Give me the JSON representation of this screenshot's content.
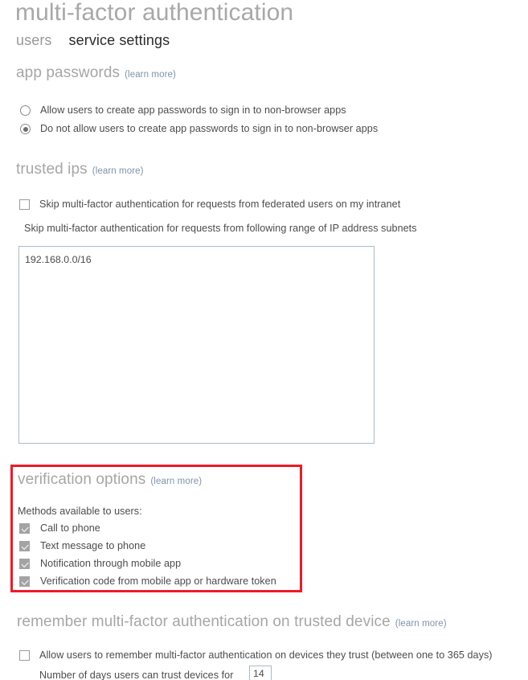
{
  "header": {
    "title": "multi-factor authentication",
    "tabs": [
      {
        "label": "users",
        "active": false
      },
      {
        "label": "service settings",
        "active": true
      }
    ]
  },
  "learn_more_label": "(learn more)",
  "sections": {
    "app_passwords": {
      "heading": "app passwords",
      "options": [
        {
          "label": "Allow users to create app passwords to sign in to non-browser apps",
          "selected": false
        },
        {
          "label": "Do not allow users to create app passwords to sign in to non-browser apps",
          "selected": true
        }
      ]
    },
    "trusted_ips": {
      "heading": "trusted ips",
      "federated_checkbox": {
        "label": "Skip multi-factor authentication for requests from federated users on my intranet",
        "checked": false
      },
      "subnets_label": "Skip multi-factor authentication for requests from following range of IP address subnets",
      "subnets_value": "192.168.0.0/16",
      "subnets_placeholder": ""
    },
    "verification_options": {
      "heading": "verification options",
      "methods_label": "Methods available to users:",
      "methods": [
        {
          "label": "Call to phone",
          "checked": true
        },
        {
          "label": "Text message to phone",
          "checked": true
        },
        {
          "label": "Notification through mobile app",
          "checked": true
        },
        {
          "label": "Verification code from mobile app or hardware token",
          "checked": true
        }
      ],
      "highlight_color": "#ee1b24"
    },
    "remember_mfa": {
      "heading": "remember multi-factor authentication on trusted device",
      "allow_checkbox": {
        "label": "Allow users to remember multi-factor authentication on devices they trust (between one to 365 days)",
        "checked": false
      },
      "days_label": "Number of days users can trust devices for",
      "days_value": "14"
    }
  },
  "colors": {
    "heading": "#a6a6a6",
    "body_text": "#4c4c4c",
    "link": "#7f93ab",
    "field_border": "#a9bacb",
    "checkbox_fill": "#a3a3a3",
    "highlight": "#ee1b24"
  }
}
